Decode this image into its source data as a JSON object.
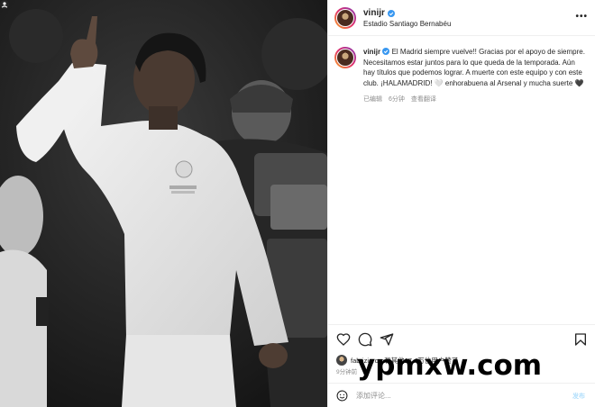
{
  "post": {
    "username": "vinijr",
    "location": "Estadio Santiago Bernabéu",
    "caption": "El Madrid siempre vuelve!! Gracias por el apoyo de siempre. Necesitamos estar juntos para lo que queda de la temporada. Aún hay títulos que podemos lograr. A muerte con este equipo y con este club. ¡HALAMADRID! 🤍 enhorabuena al Arsenal y mucha suerte 🖤",
    "edited_label": "已编辑",
    "time_ago": "6分钟",
    "translate_label": "查看翻译",
    "likes_text": "fabriziorom和其他17.4万位用户赞了",
    "post_time": "9分钟前",
    "comment_placeholder": "添加评论...",
    "post_button": "发布"
  },
  "watermark": "ypmxw.com",
  "icons": {
    "like": "heart-icon",
    "comment": "comment-icon",
    "share": "send-icon",
    "save": "bookmark-icon",
    "emoji": "emoji-icon",
    "more": "more-icon",
    "verified": "verified-badge-icon"
  },
  "colors": {
    "verified": "#3897f0",
    "muted": "#8e8e8e",
    "post_button": "#b2dffc"
  }
}
